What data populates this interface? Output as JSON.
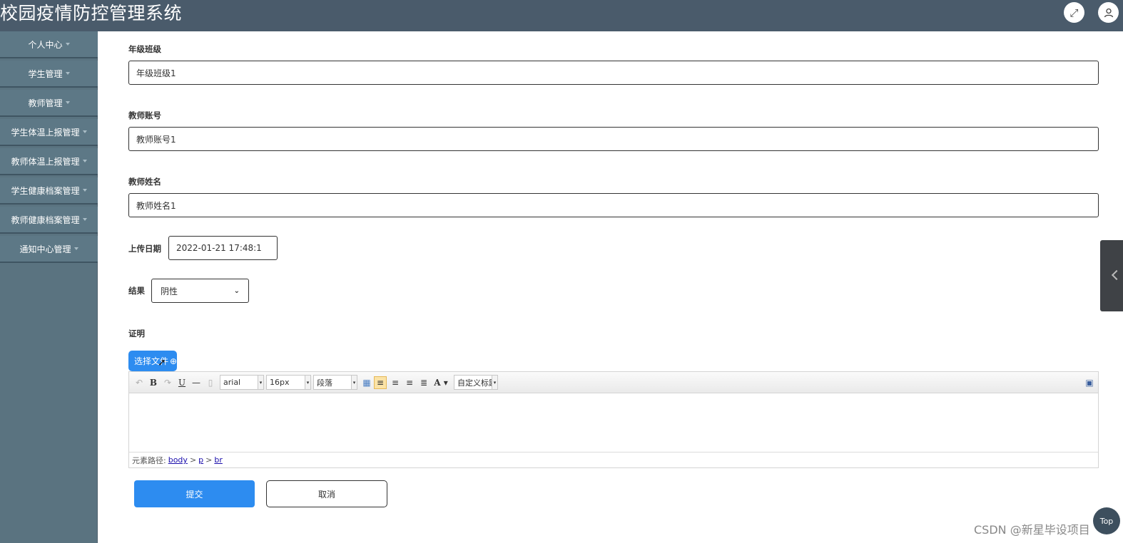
{
  "header": {
    "title": "校园疫情防控管理系统",
    "fullscreen_icon": "expand-icon",
    "user_icon": "user-icon"
  },
  "sidebar": {
    "items": [
      {
        "label": "个人中心"
      },
      {
        "label": "学生管理"
      },
      {
        "label": "教师管理"
      },
      {
        "label": "学生体温上报管理"
      },
      {
        "label": "教师体温上报管理"
      },
      {
        "label": "学生健康档案管理"
      },
      {
        "label": "教师健康档案管理"
      },
      {
        "label": "通知中心管理"
      }
    ]
  },
  "form": {
    "grade_class": {
      "label": "年级班级",
      "value": "年级班级1"
    },
    "teacher_account": {
      "label": "教师账号",
      "value": "教师账号1"
    },
    "teacher_name": {
      "label": "教师姓名",
      "value": "教师姓名1"
    },
    "upload_date": {
      "label": "上传日期",
      "value": "2022-01-21 17:48:1"
    },
    "result": {
      "label": "结果",
      "selected": "阴性"
    },
    "proof": {
      "label": "证明",
      "upload_label": "选择文件"
    }
  },
  "editor": {
    "font_family": "arial",
    "font_size": "16px",
    "paragraph": "段落",
    "custom_title": "自定义标题",
    "path_label": "元素路径:",
    "path": [
      "body",
      "p",
      "br"
    ]
  },
  "actions": {
    "submit": "提交",
    "cancel": "取消"
  },
  "top_button": "Top",
  "watermark": "CSDN @新星毕设项目"
}
